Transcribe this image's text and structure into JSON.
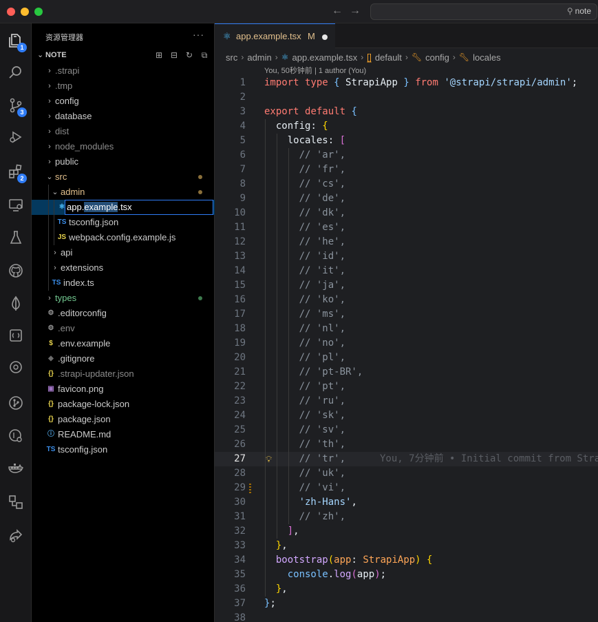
{
  "titlebar": {
    "search_text": "note"
  },
  "activity": {
    "items": [
      {
        "name": "explorer",
        "badge": "1"
      },
      {
        "name": "search",
        "badge": ""
      },
      {
        "name": "source-control",
        "badge": "3"
      },
      {
        "name": "run-debug",
        "badge": ""
      },
      {
        "name": "extensions",
        "badge": "2"
      },
      {
        "name": "remote-explorer",
        "badge": ""
      },
      {
        "name": "testing",
        "badge": ""
      },
      {
        "name": "github",
        "badge": ""
      },
      {
        "name": "mongodb",
        "badge": ""
      },
      {
        "name": "docker-compose",
        "badge": ""
      },
      {
        "name": "gitlens",
        "badge": ""
      },
      {
        "name": "git-graph",
        "badge": ""
      },
      {
        "name": "gitlens-inspect",
        "badge": ""
      },
      {
        "name": "docker",
        "badge": ""
      },
      {
        "name": "workspaces",
        "badge": ""
      },
      {
        "name": "live-share",
        "badge": ""
      }
    ]
  },
  "sidebar": {
    "title": "资源管理器",
    "project": "NOTE",
    "tree": [
      {
        "label": ".strapi",
        "type": "folder",
        "open": false,
        "depth": 0,
        "color": "#8b8b8b",
        "dot": ""
      },
      {
        "label": ".tmp",
        "type": "folder",
        "open": false,
        "depth": 0,
        "color": "#8b8b8b",
        "dot": ""
      },
      {
        "label": "config",
        "type": "folder",
        "open": false,
        "depth": 0,
        "color": "#cccccc",
        "dot": ""
      },
      {
        "label": "database",
        "type": "folder",
        "open": false,
        "depth": 0,
        "color": "#cccccc",
        "dot": ""
      },
      {
        "label": "dist",
        "type": "folder",
        "open": false,
        "depth": 0,
        "color": "#8b8b8b",
        "dot": ""
      },
      {
        "label": "node_modules",
        "type": "folder",
        "open": false,
        "depth": 0,
        "color": "#8b8b8b",
        "dot": ""
      },
      {
        "label": "public",
        "type": "folder",
        "open": false,
        "depth": 0,
        "color": "#cccccc",
        "dot": ""
      },
      {
        "label": "src",
        "type": "folder",
        "open": true,
        "depth": 0,
        "color": "#e2c08d",
        "dot": "#8a6f3a"
      },
      {
        "label": "admin",
        "type": "folder",
        "open": true,
        "depth": 1,
        "color": "#e2c08d",
        "dot": "#8a6f3a"
      },
      {
        "label": "app.example.tsx",
        "type": "tsx",
        "depth": 2,
        "color": "#ffffff",
        "dot": "",
        "rename": true
      },
      {
        "label": "tsconfig.json",
        "type": "tsjson",
        "depth": 2,
        "color": "#cccccc",
        "dot": ""
      },
      {
        "label": "webpack.config.example.js",
        "type": "js",
        "depth": 2,
        "color": "#cccccc",
        "dot": ""
      },
      {
        "label": "api",
        "type": "folder",
        "open": false,
        "depth": 1,
        "color": "#cccccc",
        "dot": ""
      },
      {
        "label": "extensions",
        "type": "folder",
        "open": false,
        "depth": 1,
        "color": "#cccccc",
        "dot": ""
      },
      {
        "label": "index.ts",
        "type": "ts",
        "depth": 1,
        "color": "#cccccc",
        "dot": ""
      },
      {
        "label": "types",
        "type": "folder",
        "open": false,
        "depth": 0,
        "color": "#73c991",
        "dot": "#3d7a4d"
      },
      {
        "label": ".editorconfig",
        "type": "gear",
        "depth": 0,
        "color": "#cccccc",
        "dot": ""
      },
      {
        "label": ".env",
        "type": "gear",
        "depth": 0,
        "color": "#8b8b8b",
        "dot": ""
      },
      {
        "label": ".env.example",
        "type": "dollar",
        "depth": 0,
        "color": "#cccccc",
        "dot": ""
      },
      {
        "label": ".gitignore",
        "type": "git",
        "depth": 0,
        "color": "#cccccc",
        "dot": ""
      },
      {
        "label": ".strapi-updater.json",
        "type": "json",
        "depth": 0,
        "color": "#8b8b8b",
        "dot": ""
      },
      {
        "label": "favicon.png",
        "type": "image",
        "depth": 0,
        "color": "#cccccc",
        "dot": ""
      },
      {
        "label": "package-lock.json",
        "type": "json",
        "depth": 0,
        "color": "#cccccc",
        "dot": ""
      },
      {
        "label": "package.json",
        "type": "json",
        "depth": 0,
        "color": "#cccccc",
        "dot": ""
      },
      {
        "label": "README.md",
        "type": "info",
        "depth": 0,
        "color": "#cccccc",
        "dot": ""
      },
      {
        "label": "tsconfig.json",
        "type": "tsjson",
        "depth": 0,
        "color": "#cccccc",
        "dot": ""
      }
    ],
    "rename_prefix": "app.",
    "rename_selected": "example",
    "rename_suffix": ".tsx"
  },
  "editor": {
    "tab": {
      "name": "app.example.tsx",
      "modified": "M"
    },
    "breadcrumb": [
      "src",
      "admin",
      "app.example.tsx",
      "default",
      "config",
      "locales"
    ],
    "blame": "You, 50秒钟前 | 1 author (You)",
    "inline_blame": "You, 7分钟前 • Initial commit from Stra",
    "current_line": 27,
    "lines": [
      [
        [
          "import",
          "k"
        ],
        [
          " ",
          "p"
        ],
        [
          "type",
          "k"
        ],
        [
          " ",
          "p"
        ],
        [
          "{",
          "b"
        ],
        [
          " StrapiApp ",
          "p"
        ],
        [
          "}",
          "b"
        ],
        [
          " ",
          "p"
        ],
        [
          "from",
          "k"
        ],
        [
          " ",
          "p"
        ],
        [
          "'@strapi/strapi/admin'",
          "s"
        ],
        [
          ";",
          "p"
        ]
      ],
      [],
      [
        [
          "export",
          "k"
        ],
        [
          " ",
          "p"
        ],
        [
          "default",
          "k"
        ],
        [
          " ",
          "p"
        ],
        [
          "{",
          "b"
        ]
      ],
      [
        [
          "  config",
          "p"
        ],
        [
          ": ",
          "p"
        ],
        [
          "{",
          "br1"
        ]
      ],
      [
        [
          "    locales",
          "p"
        ],
        [
          ": ",
          "p"
        ],
        [
          "[",
          "br2"
        ]
      ],
      [
        [
          "      // 'ar',",
          "c"
        ]
      ],
      [
        [
          "      // 'fr',",
          "c"
        ]
      ],
      [
        [
          "      // 'cs',",
          "c"
        ]
      ],
      [
        [
          "      // 'de',",
          "c"
        ]
      ],
      [
        [
          "      // 'dk',",
          "c"
        ]
      ],
      [
        [
          "      // 'es',",
          "c"
        ]
      ],
      [
        [
          "      // 'he',",
          "c"
        ]
      ],
      [
        [
          "      // 'id',",
          "c"
        ]
      ],
      [
        [
          "      // 'it',",
          "c"
        ]
      ],
      [
        [
          "      // 'ja',",
          "c"
        ]
      ],
      [
        [
          "      // 'ko',",
          "c"
        ]
      ],
      [
        [
          "      // 'ms',",
          "c"
        ]
      ],
      [
        [
          "      // 'nl',",
          "c"
        ]
      ],
      [
        [
          "      // 'no',",
          "c"
        ]
      ],
      [
        [
          "      // 'pl',",
          "c"
        ]
      ],
      [
        [
          "      // 'pt-BR',",
          "c"
        ]
      ],
      [
        [
          "      // 'pt',",
          "c"
        ]
      ],
      [
        [
          "      // 'ru',",
          "c"
        ]
      ],
      [
        [
          "      // 'sk',",
          "c"
        ]
      ],
      [
        [
          "      // 'sv',",
          "c"
        ]
      ],
      [
        [
          "      // 'th',",
          "c"
        ]
      ],
      [
        [
          "      // 'tr',",
          "c"
        ]
      ],
      [
        [
          "      // 'uk',",
          "c"
        ]
      ],
      [
        [
          "      // 'vi',",
          "c"
        ]
      ],
      [
        [
          "      ",
          "p"
        ],
        [
          "'zh-Hans'",
          "str2"
        ],
        [
          ",",
          "p"
        ]
      ],
      [
        [
          "      // 'zh',",
          "c"
        ]
      ],
      [
        [
          "    ",
          "p"
        ],
        [
          "]",
          "br2"
        ],
        [
          ",",
          "p"
        ]
      ],
      [
        [
          "  ",
          "p"
        ],
        [
          "}",
          "br1"
        ],
        [
          ",",
          "p"
        ]
      ],
      [
        [
          "  ",
          "p"
        ],
        [
          "bootstrap",
          "fn"
        ],
        [
          "(",
          "br1"
        ],
        [
          "app",
          "ty"
        ],
        [
          ": ",
          "p"
        ],
        [
          "StrapiApp",
          "ty"
        ],
        [
          ")",
          "br1"
        ],
        [
          " ",
          "p"
        ],
        [
          "{",
          "br1"
        ]
      ],
      [
        [
          "    console",
          "b"
        ],
        [
          ".",
          "p"
        ],
        [
          "log",
          "fn"
        ],
        [
          "(",
          "br2"
        ],
        [
          "app",
          "p"
        ],
        [
          ")",
          "br2"
        ],
        [
          ";",
          "p"
        ]
      ],
      [
        [
          "  ",
          "p"
        ],
        [
          "}",
          "br1"
        ],
        [
          ",",
          "p"
        ]
      ],
      [
        [
          "}",
          "b"
        ],
        [
          ";",
          "p"
        ]
      ],
      []
    ]
  }
}
